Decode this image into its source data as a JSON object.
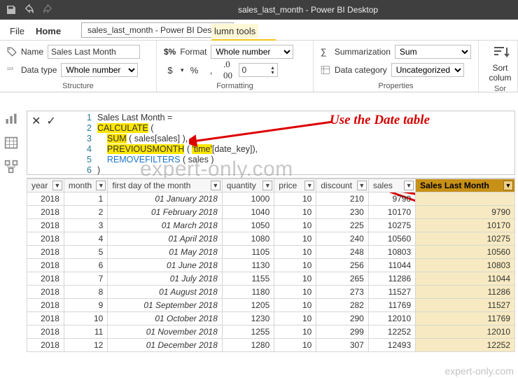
{
  "app": {
    "title": "sales_last_month - Power BI Desktop"
  },
  "tabs": {
    "file": "File",
    "home": "Home",
    "tooltip": "sales_last_month - Power BI Desktop",
    "column_tools": "lumn tools"
  },
  "ribbon": {
    "structure": {
      "name_label": "Name",
      "name_value": "Sales Last Month",
      "datatype_label": "Data type",
      "datatype_value": "Whole number",
      "group": "Structure"
    },
    "formatting": {
      "format_label": "Format",
      "format_value": "Whole number",
      "decimals": "0",
      "btn_currency": "$",
      "btn_percent": "%",
      "btn_thousands": ",",
      "group": "Formatting"
    },
    "properties": {
      "summarization_label": "Summarization",
      "summarization_value": "Sum",
      "category_label": "Data category",
      "category_value": "Uncategorized",
      "group": "Properties"
    },
    "sort": {
      "label1": "Sort",
      "label2": "colum",
      "group": "Sor"
    }
  },
  "formula": {
    "l1": "Sales Last Month =",
    "l2a": "CALCULATE",
    "l2b": " (",
    "l3a": "SUM",
    "l3b": " ( sales[sales] ),",
    "l4a": "PREVIOUSMONTH",
    "l4b": " ( ",
    "l4c": "'time'",
    "l4d": "[date_key]),",
    "l5a": "REMOVEFILTERS",
    "l5b": " ( sales )",
    "l6": ")"
  },
  "callout": "Use the Date table",
  "columns": [
    "year",
    "month",
    "first day of the month",
    "quantity",
    "price",
    "discount",
    "sales",
    "Sales Last Month"
  ],
  "rows": [
    {
      "y": "2018",
      "m": "1",
      "f": "01 January 2018",
      "q": "1000",
      "p": "10",
      "d": "210",
      "s": "9790",
      "slm": ""
    },
    {
      "y": "2018",
      "m": "2",
      "f": "01 February 2018",
      "q": "1040",
      "p": "10",
      "d": "230",
      "s": "10170",
      "slm": "9790"
    },
    {
      "y": "2018",
      "m": "3",
      "f": "01 March 2018",
      "q": "1050",
      "p": "10",
      "d": "225",
      "s": "10275",
      "slm": "10170"
    },
    {
      "y": "2018",
      "m": "4",
      "f": "01 April 2018",
      "q": "1080",
      "p": "10",
      "d": "240",
      "s": "10560",
      "slm": "10275"
    },
    {
      "y": "2018",
      "m": "5",
      "f": "01 May 2018",
      "q": "1105",
      "p": "10",
      "d": "248",
      "s": "10803",
      "slm": "10560"
    },
    {
      "y": "2018",
      "m": "6",
      "f": "01 June 2018",
      "q": "1130",
      "p": "10",
      "d": "256",
      "s": "11044",
      "slm": "10803"
    },
    {
      "y": "2018",
      "m": "7",
      "f": "01 July 2018",
      "q": "1155",
      "p": "10",
      "d": "265",
      "s": "11286",
      "slm": "11044"
    },
    {
      "y": "2018",
      "m": "8",
      "f": "01 August 2018",
      "q": "1180",
      "p": "10",
      "d": "273",
      "s": "11527",
      "slm": "11286"
    },
    {
      "y": "2018",
      "m": "9",
      "f": "01 September 2018",
      "q": "1205",
      "p": "10",
      "d": "282",
      "s": "11769",
      "slm": "11527"
    },
    {
      "y": "2018",
      "m": "10",
      "f": "01 October 2018",
      "q": "1230",
      "p": "10",
      "d": "290",
      "s": "12010",
      "slm": "11769"
    },
    {
      "y": "2018",
      "m": "11",
      "f": "01 November 2018",
      "q": "1255",
      "p": "10",
      "d": "299",
      "s": "12252",
      "slm": "12010"
    },
    {
      "y": "2018",
      "m": "12",
      "f": "01 December 2018",
      "q": "1280",
      "p": "10",
      "d": "307",
      "s": "12493",
      "slm": "12252"
    }
  ],
  "watermark": "expert-only.com",
  "watermark2": "expert-only.com"
}
